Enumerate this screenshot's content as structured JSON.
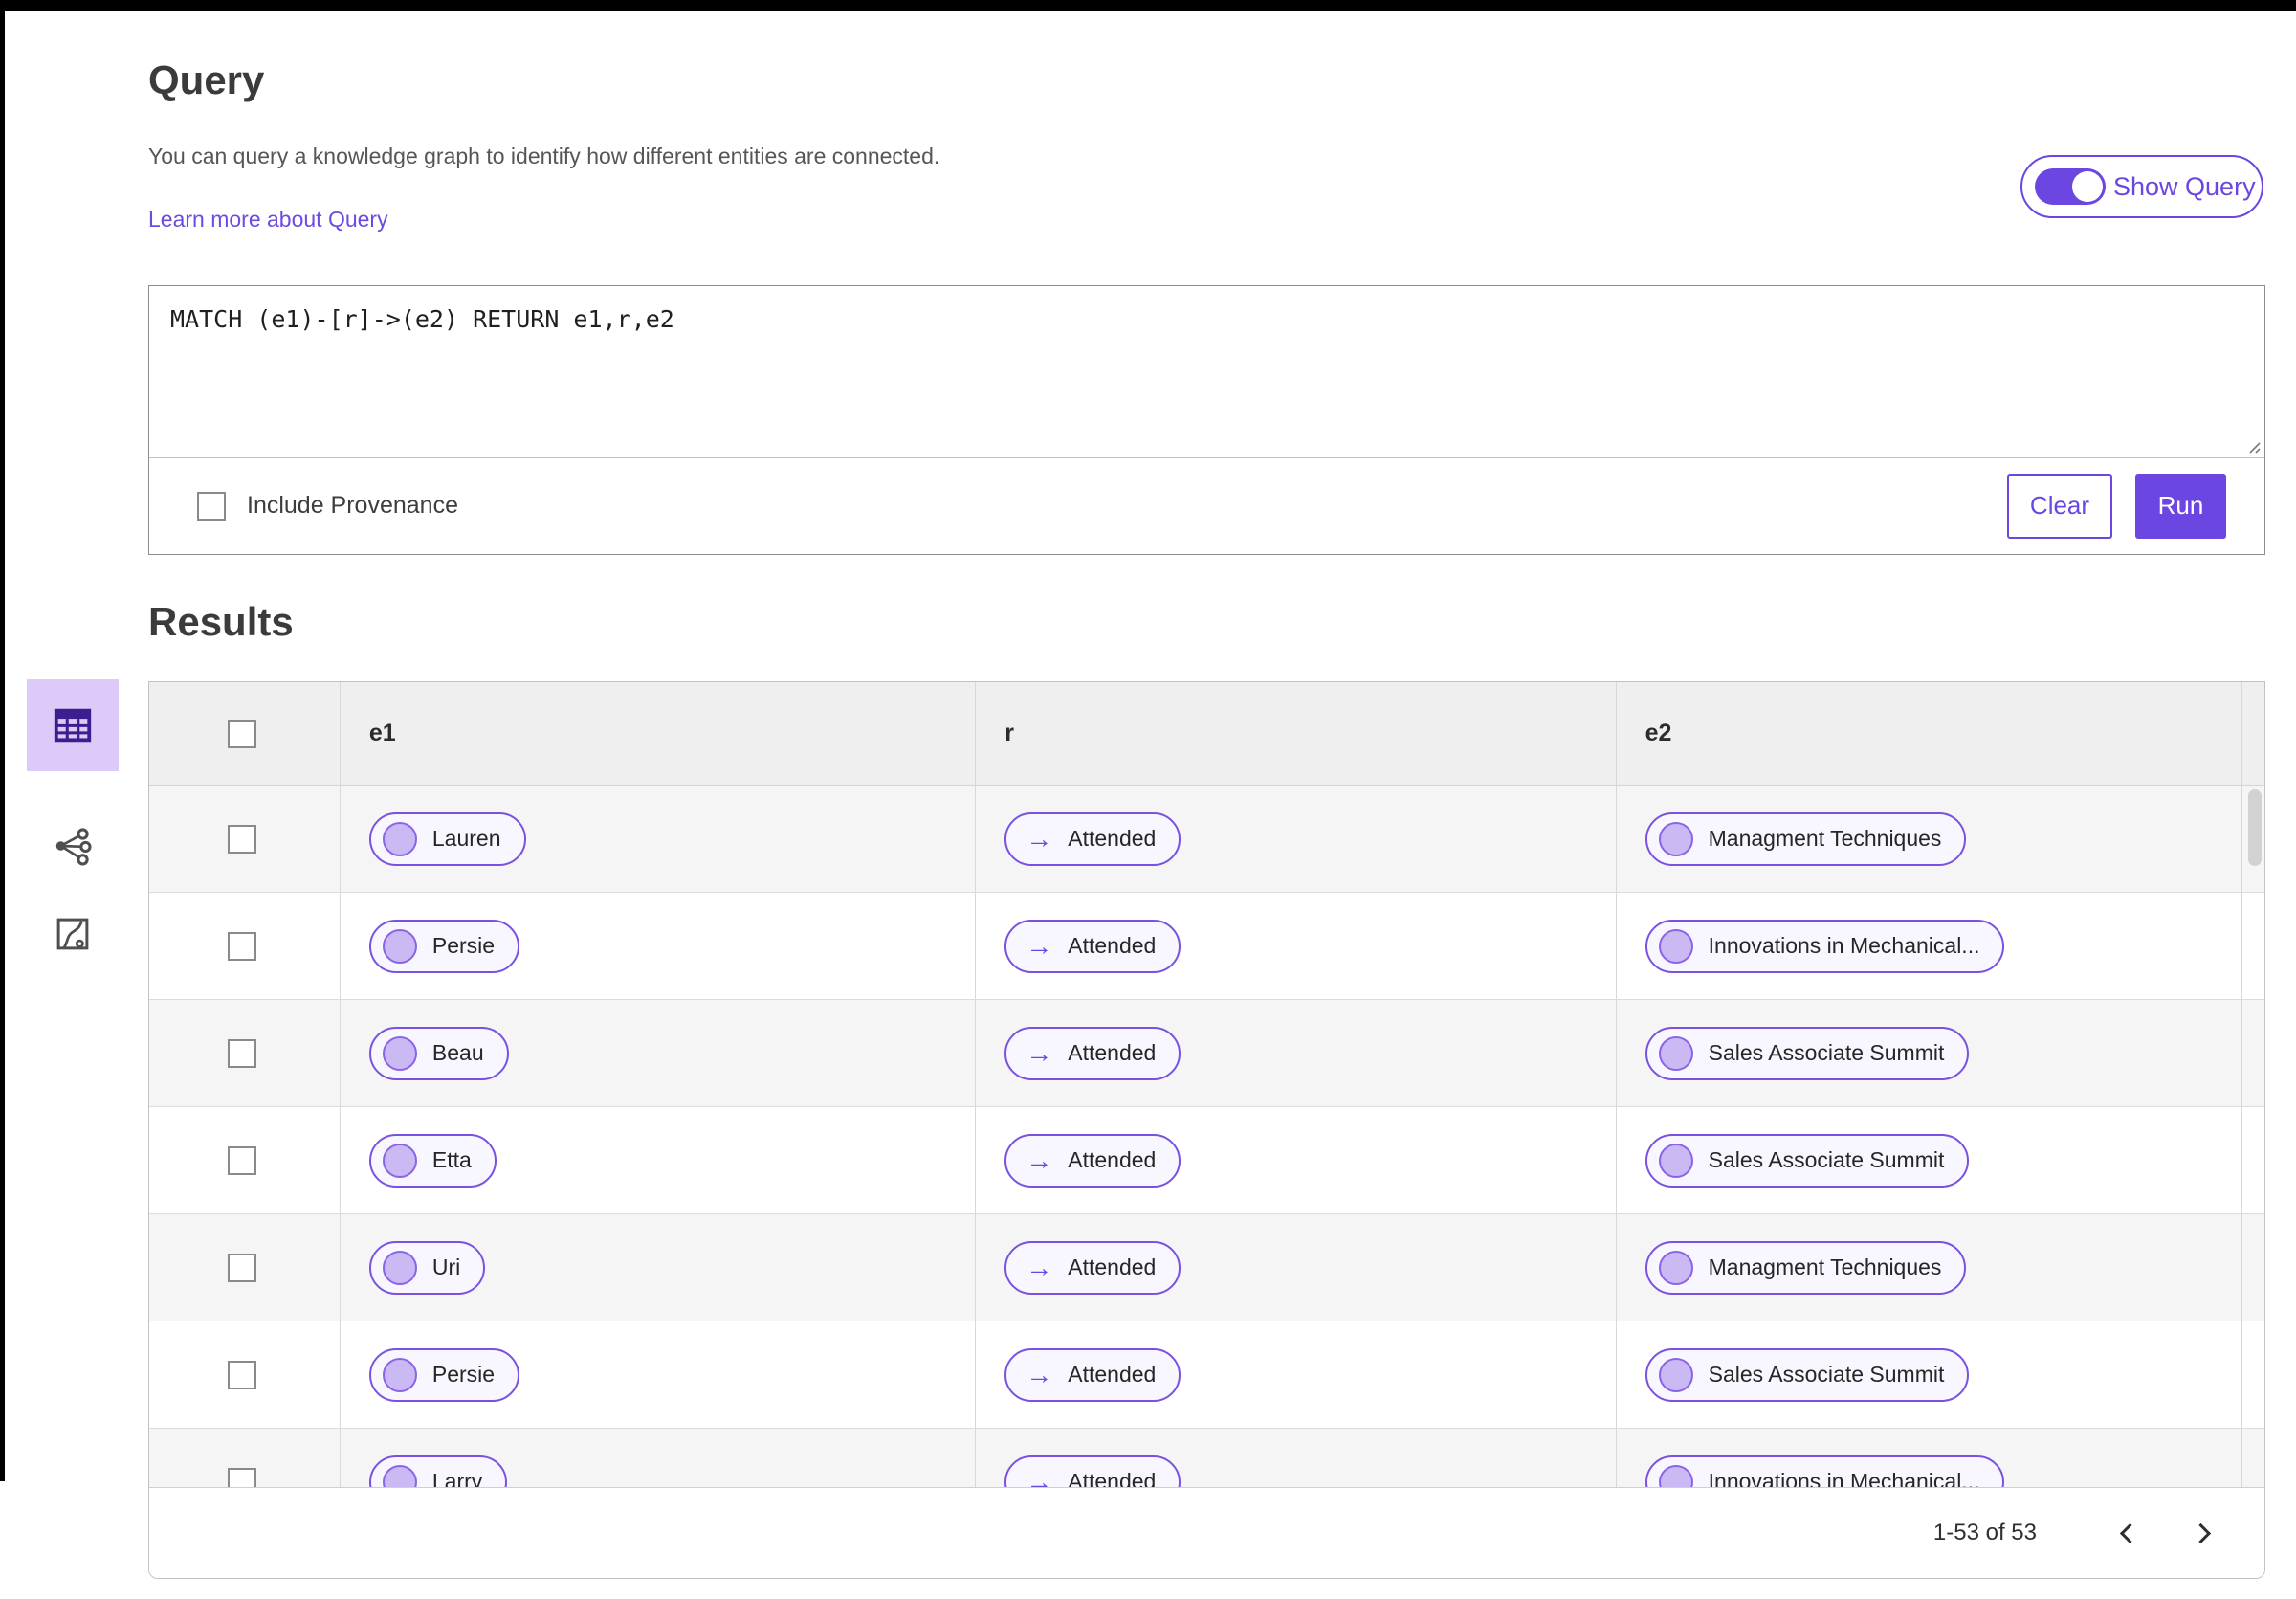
{
  "colors": {
    "accent": "#6b46e0",
    "link": "#6d4ae0",
    "pill_border": "#7a52e0",
    "pill_bg": "#f8f6fe",
    "node_fill": "#cbb9f4",
    "node_border": "#8a63e8",
    "selected_tool_bg": "#dccbf8",
    "table_icon": "#3b1f8f",
    "gray_icon": "#4f4f4f"
  },
  "query": {
    "title": "Query",
    "description": "You can query a knowledge graph to identify how different entities are connected.",
    "learn_more_label": "Learn more about Query",
    "show_query_label": "Show Query",
    "editor_text": "MATCH (e1)-[r]->(e2) RETURN e1,r,e2",
    "include_provenance_label": "Include Provenance",
    "clear_label": "Clear",
    "run_label": "Run"
  },
  "results": {
    "title": "Results",
    "table": {
      "columns": [
        "e1",
        "r",
        "e2"
      ],
      "relation_arrow": "→",
      "rows": [
        {
          "e1": "Lauren",
          "r": "Attended",
          "e2": "Managment Techniques"
        },
        {
          "e1": "Persie",
          "r": "Attended",
          "e2": "Innovations in Mechanical..."
        },
        {
          "e1": "Beau",
          "r": "Attended",
          "e2": "Sales Associate Summit"
        },
        {
          "e1": "Etta",
          "r": "Attended",
          "e2": "Sales Associate Summit"
        },
        {
          "e1": "Uri",
          "r": "Attended",
          "e2": "Managment Techniques"
        },
        {
          "e1": "Persie",
          "r": "Attended",
          "e2": "Sales Associate Summit"
        },
        {
          "e1": "Larry",
          "r": "Attended",
          "e2": "Innovations in Mechanical..."
        }
      ]
    },
    "pagination": {
      "range_label": "1-53 of 53"
    }
  }
}
